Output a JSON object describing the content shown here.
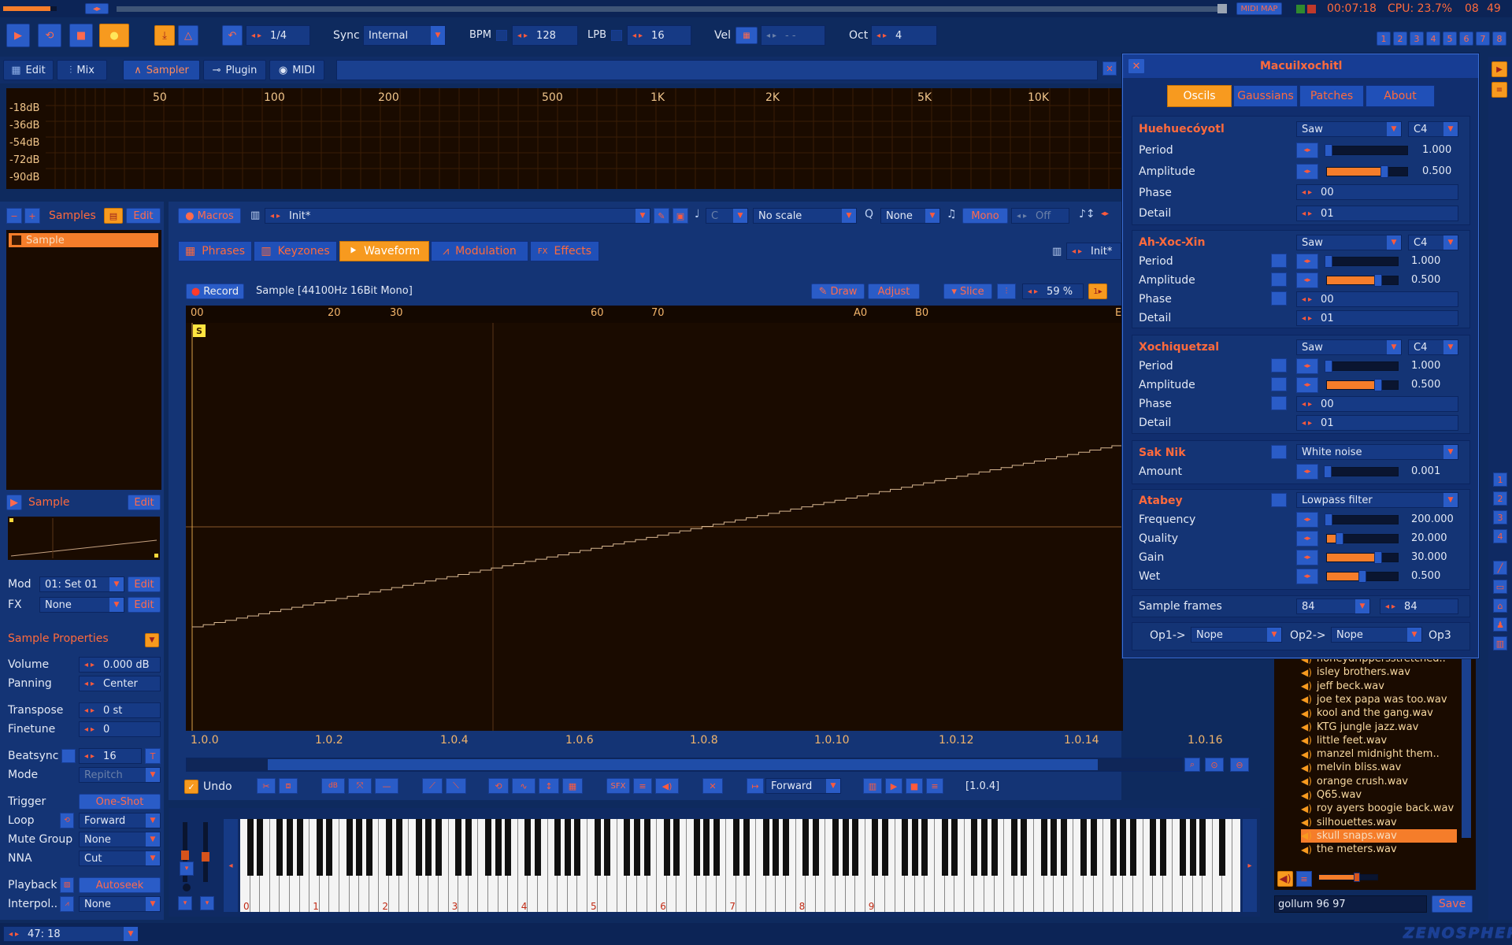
{
  "app": {
    "brand": "ZENOSPHERE",
    "status": "47: 18"
  },
  "topbar": {
    "midi_map": "MIDI MAP",
    "time": "00:07:18",
    "cpu": "CPU: 23.7%",
    "v1": "08",
    "v2": "49"
  },
  "toolbar": {
    "pattern": "1/4",
    "sync_label": "Sync",
    "sync_value": "Internal",
    "bpm_label": "BPM",
    "bpm": "128",
    "lpb_label": "LPB",
    "lpb": "16",
    "vel_label": "Vel",
    "vel": "- -",
    "oct_label": "Oct",
    "oct": "4",
    "tracks": [
      "1",
      "2",
      "3",
      "4",
      "5",
      "6",
      "7",
      "8"
    ]
  },
  "nav": {
    "edit": "Edit",
    "mix": "Mix",
    "sampler": "Sampler",
    "plugin": "Plugin",
    "midi": "MIDI"
  },
  "spectrum": {
    "db": [
      "-18dB",
      "-36dB",
      "-54dB",
      "-72dB",
      "-90dB"
    ],
    "freq": [
      "50",
      "100",
      "200",
      "500",
      "1K",
      "2K",
      "5K",
      "10K"
    ]
  },
  "samples": {
    "title": "Samples",
    "edit": "Edit",
    "items": [
      "Sample"
    ],
    "selected_label": "Sample",
    "selected_edit": "Edit"
  },
  "modfx": {
    "mod_label": "Mod",
    "mod": "01: Set 01",
    "fx_label": "FX",
    "fx": "None",
    "edit": "Edit"
  },
  "props": {
    "title": "Sample Properties",
    "rows": [
      {
        "label": "Volume",
        "value": "0.000 dB"
      },
      {
        "label": "Panning",
        "value": "Center"
      },
      {
        "label": "Transpose",
        "value": "0 st"
      },
      {
        "label": "Finetune",
        "value": "0"
      },
      {
        "label": "Beatsync",
        "value": "16"
      },
      {
        "label": "Mode",
        "value": "Repitch"
      },
      {
        "label": "Trigger",
        "value": "One-Shot"
      },
      {
        "label": "Loop",
        "value": "Forward"
      },
      {
        "label": "Mute Group",
        "value": "None"
      },
      {
        "label": "NNA",
        "value": "Cut"
      },
      {
        "label": "Playback",
        "value": "Autoseek"
      },
      {
        "label": "Interpol..",
        "value": "None"
      }
    ]
  },
  "macros": {
    "label": "Macros",
    "preset": "Init*",
    "note": "C",
    "scale": "No scale",
    "quant": "None",
    "mono": "Mono",
    "off": "Off"
  },
  "subtabs": {
    "phrases": "Phrases",
    "keyzones": "Keyzones",
    "waveform": "Waveform",
    "modulation": "Modulation",
    "effects": "Effects",
    "preset": "Init*"
  },
  "wave": {
    "record": "Record",
    "info": "Sample [44100Hz 16Bit Mono]",
    "draw": "Draw",
    "adjust": "Adjust",
    "slice": "Slice",
    "zoom": "59 %",
    "ruler": [
      "00",
      "20",
      "30",
      "60",
      "70",
      "A0",
      "B0",
      "E"
    ],
    "xticks": [
      "1.0.0",
      "1.0.2",
      "1.0.4",
      "1.0.6",
      "1.0.8",
      "1.0.10",
      "1.0.12",
      "1.0.14",
      "1.0.16"
    ],
    "start": "S",
    "end": "E",
    "undo": "Undo",
    "sfx": "SFX",
    "direction": "Forward",
    "position": "[1.0.4]"
  },
  "plugin": {
    "title": "Macuilxochitl",
    "tabs": [
      "Oscils",
      "Gaussians",
      "Patches",
      "About"
    ],
    "osc1": {
      "name": "Huehuecóyotl",
      "wave": "Saw",
      "note": "C4",
      "period": "1.000",
      "period_pct": 0.02,
      "amp": "0.500",
      "amp_pct": 0.72,
      "phase": "00",
      "detail": "01"
    },
    "osc2": {
      "name": "Ah-Xoc-Xin",
      "wave": "Saw",
      "note": "C4",
      "period": "1.000",
      "period_pct": 0.02,
      "amp": "0.500",
      "amp_pct": 0.72,
      "phase": "00",
      "detail": "01"
    },
    "osc3": {
      "name": "Xochiquetzal",
      "wave": "Saw",
      "note": "C4",
      "period": "1.000",
      "period_pct": 0.02,
      "amp": "0.500",
      "amp_pct": 0.72,
      "phase": "00",
      "detail": "01"
    },
    "labels": {
      "period": "Period",
      "amplitude": "Amplitude",
      "phase": "Phase",
      "detail": "Detail",
      "amount": "Amount",
      "frequency": "Frequency",
      "quality": "Quality",
      "gain": "Gain",
      "wet": "Wet"
    },
    "noise": {
      "name": "Sak Nik",
      "type": "White noise",
      "amount": "0.001",
      "amount_pct": 0.01
    },
    "filter": {
      "name": "Atabey",
      "type": "Lowpass filter",
      "frequency": "200.000",
      "freq_pct": 0.02,
      "quality": "20.000",
      "quality_pct": 0.18,
      "gain": "30.000",
      "gain_pct": 0.72,
      "wet": "0.500",
      "wet_pct": 0.5
    },
    "frames_label": "Sample frames",
    "frames": "84",
    "frames2": "84",
    "op1_label": "Op1->",
    "op1": "Nope",
    "op2_label": "Op2->",
    "op2": "Nope",
    "op3_label": "Op3"
  },
  "browser": {
    "files": [
      "honeydrippersstretched..",
      "isley brothers.wav",
      "jeff beck.wav",
      "joe tex papa was too.wav",
      "kool and the gang.wav",
      "KTG jungle jazz.wav",
      "little feet.wav",
      "manzel midnight them..",
      "melvin bliss.wav",
      "orange crush.wav",
      "Q65.wav",
      "roy ayers boogie back.wav",
      "silhouettes.wav",
      "skull snaps.wav",
      "the meters.wav"
    ],
    "selected": "skull snaps.wav",
    "filename": "gollum 96 97",
    "save": "Save"
  },
  "keyboard": {
    "octaves": [
      "0",
      "1",
      "2",
      "3",
      "4",
      "5",
      "6",
      "7",
      "8",
      "9"
    ]
  },
  "colors": {
    "accent": "#f79a1f",
    "panel": "#143475",
    "dark": "#1a0b00",
    "text_orange": "#ff6a3c"
  }
}
